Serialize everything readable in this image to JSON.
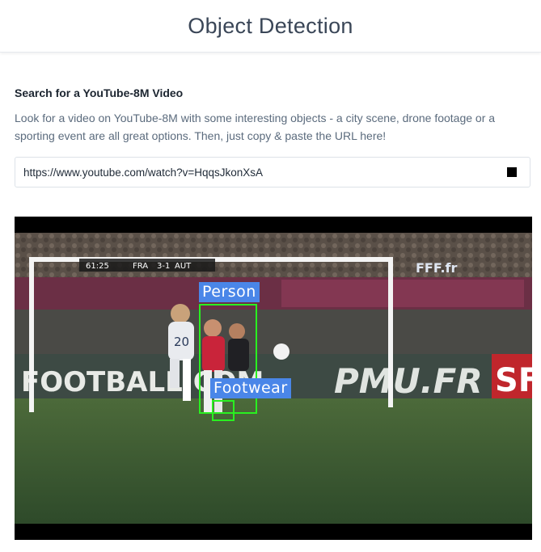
{
  "header": {
    "title": "Object Detection"
  },
  "search": {
    "heading": "Search for a YouTube-8M Video",
    "description": "Look for a video on YouTube-8M with some interesting objects - a city scene, drone footage or a sporting event are all great options. Then, just copy & paste the URL here!",
    "url_value": "https://www.youtube.com/watch?v=HqqsJkonXsA"
  },
  "video": {
    "scoreboard": {
      "clock": "61:25",
      "home": "FRA",
      "score": "3-1",
      "away": "AUT"
    },
    "broadcaster_logo": "FFF.fr",
    "ad_boards": [
      "FOOTBALL.COM",
      "PMU.FR",
      "SF"
    ],
    "detections": [
      {
        "label": "Person"
      },
      {
        "label": "Footwear"
      }
    ],
    "colors": {
      "box": "#29f020",
      "label_bg": "#4a86e8"
    }
  }
}
